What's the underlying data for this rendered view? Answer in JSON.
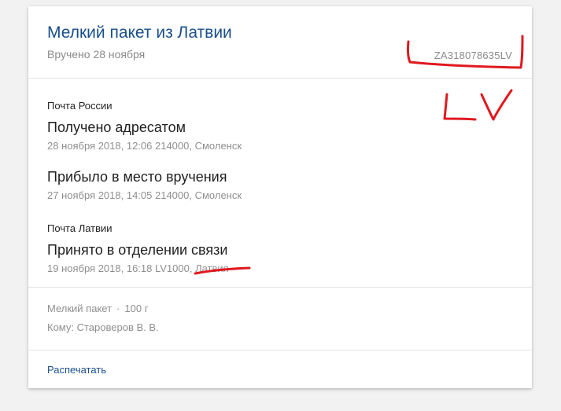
{
  "header": {
    "title": "Мелкий пакет из Латвии",
    "delivered": "Вручено 28 ноября",
    "tracking_number": "ZA318078635LV"
  },
  "events": [
    {
      "operator": "Почта России",
      "status": "Получено адресатом",
      "meta": "28 ноября 2018, 12:06 214000, Смоленск"
    },
    {
      "operator": "",
      "status": "Прибыло в место вручения",
      "meta": "27 ноября 2018, 14:05 214000, Смоленск"
    },
    {
      "operator": "Почта Латвии",
      "status": "Принято в отделении связи",
      "meta": "19 ноября 2018, 16:18 LV1000, Латвия"
    }
  ],
  "info": {
    "type": "Мелкий пакет",
    "separator": "·",
    "weight": "100 г",
    "recipient": "Кому: Староверов В. В."
  },
  "footer": {
    "print_label": "Распечатать"
  },
  "annotation": {
    "handwritten_text": "LV",
    "color": "#e0191e"
  },
  "colors": {
    "title": "#1a4f8b",
    "link": "#1a4f8b",
    "muted": "#8f8f8f",
    "background": "#f2f2f2"
  }
}
